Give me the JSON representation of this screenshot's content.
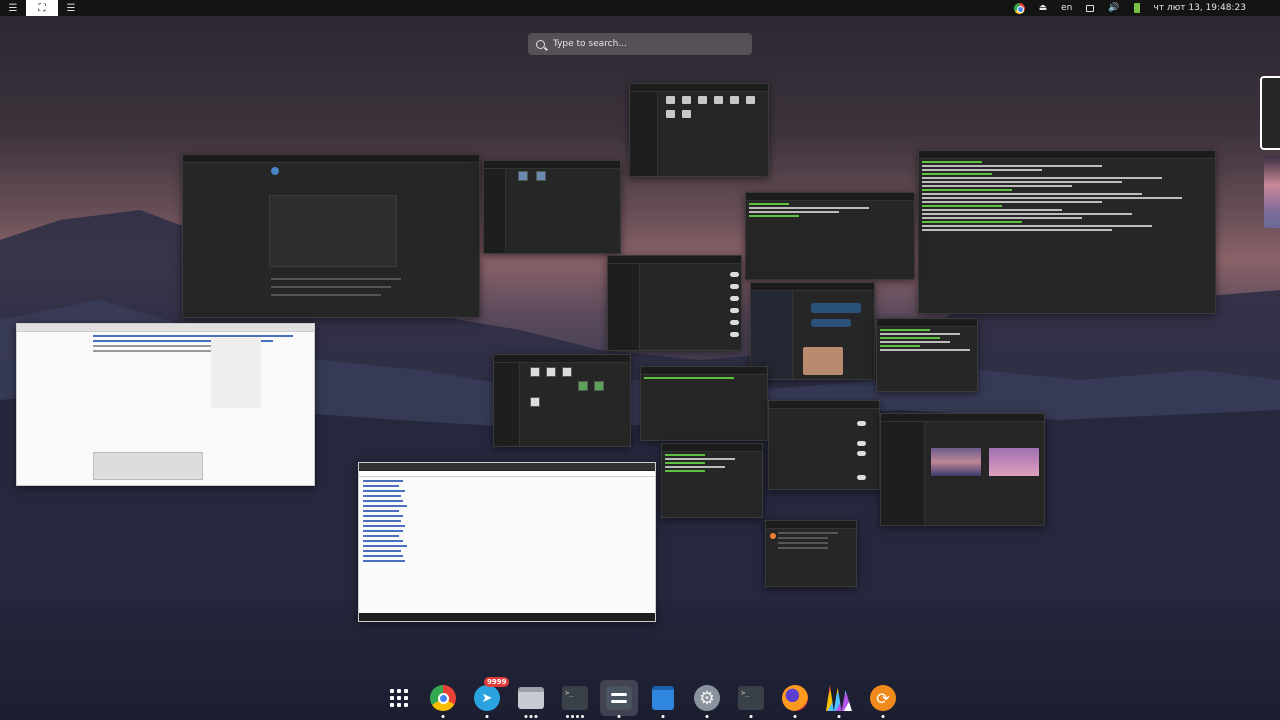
{
  "topbar": {
    "left_buttons": [
      "menu",
      "overview",
      "menu2"
    ],
    "tray": {
      "language": "en",
      "clock": "чт лют 13, 19:48:23"
    }
  },
  "search": {
    "placeholder": "Type to search..."
  },
  "dock": {
    "telegram_badge": "9999",
    "items": [
      {
        "name": "app-grid-icon"
      },
      {
        "name": "chrome-icon"
      },
      {
        "name": "telegram-icon"
      },
      {
        "name": "files-icon"
      },
      {
        "name": "terminal-icon"
      },
      {
        "name": "tweaks-icon"
      },
      {
        "name": "store-icon"
      },
      {
        "name": "settings-icon"
      },
      {
        "name": "terminal-icon-2"
      },
      {
        "name": "firefox-icon"
      },
      {
        "name": "sublime-icon"
      },
      {
        "name": "updater-icon"
      }
    ]
  },
  "colors": {
    "accent": "#4285f4",
    "badge": "#e23b3b",
    "battery": "#7ac142",
    "terminal_text": "#5fbf3f"
  }
}
